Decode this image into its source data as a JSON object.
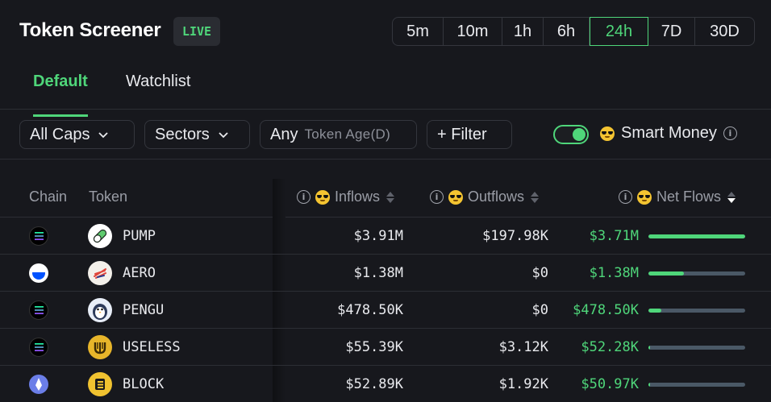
{
  "header": {
    "title": "Token Screener",
    "live_badge": "LIVE"
  },
  "timeframes": [
    "5m",
    "10m",
    "1h",
    "6h",
    "24h",
    "7D",
    "30D"
  ],
  "timeframe_selected": "24h",
  "tabs": [
    {
      "label": "Default",
      "active": true
    },
    {
      "label": "Watchlist",
      "active": false
    }
  ],
  "filters": {
    "caps": "All Caps",
    "sectors": "Sectors",
    "age_value": "Any",
    "age_label": "Token Age(D)",
    "filter": "+ Filter",
    "smart_money": "Smart Money",
    "smart_money_on": true
  },
  "table": {
    "headers": {
      "chain": "Chain",
      "token": "Token",
      "inflows": "Inflows",
      "outflows": "Outflows",
      "net_flows": "Net Flows"
    },
    "rows": [
      {
        "chain": "solana",
        "token": "PUMP",
        "inflows": "$3.91M",
        "outflows": "$197.98K",
        "net_flows": "$3.71M",
        "net_fraction": 1.0
      },
      {
        "chain": "base",
        "token": "AERO",
        "inflows": "$1.38M",
        "outflows": "$0",
        "net_flows": "$1.38M",
        "net_fraction": 0.37
      },
      {
        "chain": "solana",
        "token": "PENGU",
        "inflows": "$478.50K",
        "outflows": "$0",
        "net_flows": "$478.50K",
        "net_fraction": 0.13
      },
      {
        "chain": "solana",
        "token": "USELESS",
        "inflows": "$55.39K",
        "outflows": "$3.12K",
        "net_flows": "$52.28K",
        "net_fraction": 0.014
      },
      {
        "chain": "ethereum",
        "token": "BLOCK",
        "inflows": "$52.89K",
        "outflows": "$1.92K",
        "net_flows": "$50.97K",
        "net_fraction": 0.014
      }
    ]
  },
  "colors": {
    "accent": "#4fd67a",
    "background": "#17181d",
    "bar_track": "#4a5866"
  }
}
